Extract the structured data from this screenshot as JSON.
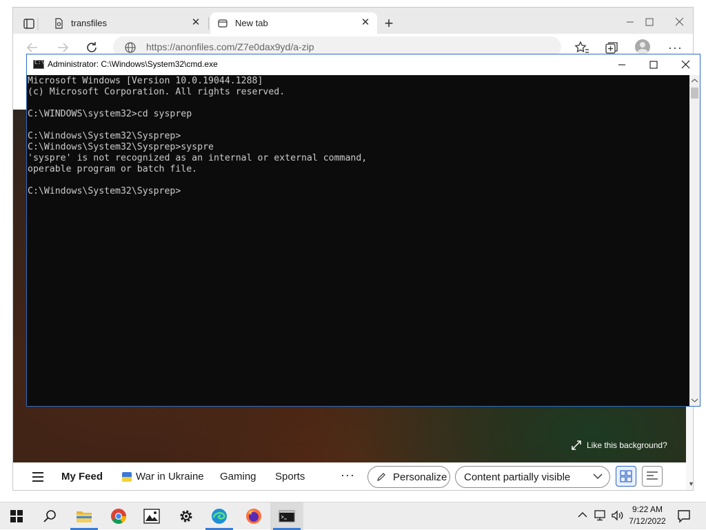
{
  "browser": {
    "tabs": [
      {
        "label": "transfiles"
      },
      {
        "label": "New tab"
      }
    ],
    "address": {
      "url": "https://anonfiles.com/Z7e0dax9yd/a-zip"
    },
    "page": {
      "like_background": "Like this background?",
      "feed": {
        "my_feed": "My Feed",
        "war_in_ukraine": "War in Ukraine",
        "gaming": "Gaming",
        "sports": "Sports",
        "more": "···",
        "personalize": "Personalize",
        "content_visibility": "Content partially visible"
      }
    }
  },
  "cmd": {
    "title": "Administrator: C:\\Windows\\System32\\cmd.exe",
    "lines": [
      "Microsoft Windows [Version 10.0.19044.1288]",
      "(c) Microsoft Corporation. All rights reserved.",
      "",
      "C:\\WINDOWS\\system32>cd sysprep",
      "",
      "C:\\Windows\\System32\\Sysprep>",
      "C:\\Windows\\System32\\Sysprep>syspre",
      "'syspre' is not recognized as an internal or external command,",
      "operable program or batch file.",
      "",
      "C:\\Windows\\System32\\Sysprep>"
    ]
  },
  "taskbar": {
    "apps": [
      "start-icon",
      "search-icon",
      "file-explorer-icon",
      "chrome-icon",
      "photos-icon",
      "settings-icon",
      "edge-icon",
      "firefox-icon",
      "cmd-icon"
    ],
    "clock": {
      "time": "9:22 AM",
      "date": "7/12/2022"
    }
  },
  "colors": {
    "accent": "#3a7bd5",
    "console_bg": "#0c0c0c",
    "console_text": "#cccccc"
  }
}
